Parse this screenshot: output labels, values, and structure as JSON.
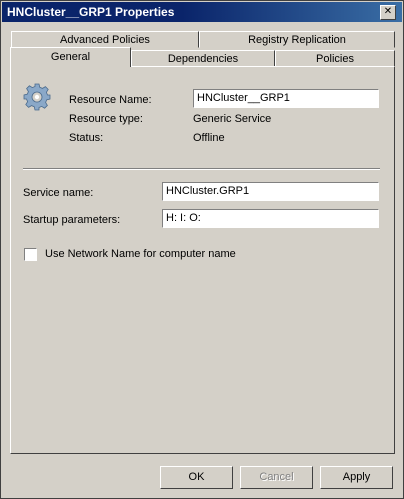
{
  "window": {
    "title": "HNCluster__GRP1 Properties",
    "close_glyph": "✕"
  },
  "tabs": {
    "back_row": [
      {
        "label": "Advanced Policies"
      },
      {
        "label": "Registry Replication"
      }
    ],
    "front_row": [
      {
        "label": "General",
        "active": true
      },
      {
        "label": "Dependencies"
      },
      {
        "label": "Policies"
      }
    ]
  },
  "resource": {
    "icon": "gear-icon",
    "name_label": "Resource Name:",
    "name_value": "HNCluster__GRP1",
    "type_label": "Resource type:",
    "type_value": "Generic Service",
    "status_label": "Status:",
    "status_value": "Offline"
  },
  "service": {
    "name_label": "Service name:",
    "name_value": "HNCluster.GRP1",
    "params_label": "Startup parameters:",
    "params_value": "H: I: O:"
  },
  "options": {
    "use_network_name_label": "Use Network Name for computer name",
    "use_network_name_checked": false
  },
  "buttons": {
    "ok": "OK",
    "cancel": "Cancel",
    "apply": "Apply"
  }
}
